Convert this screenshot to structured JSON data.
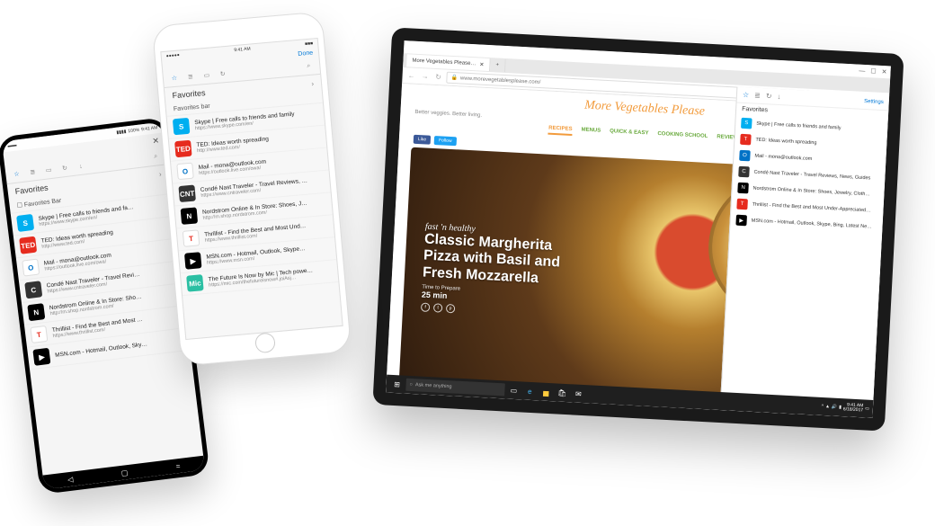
{
  "android": {
    "status": {
      "left": "▬▬",
      "battery": "100%",
      "time": "9:41 AM",
      "signal": "▮▮▮▮"
    },
    "close_glyph": "✕",
    "search_glyph": "⌕",
    "tabs": {
      "star": "☆",
      "list": "≣",
      "book": "▭",
      "clock": "↻",
      "arrow": "↓"
    },
    "header": "Favorites",
    "chevron": "›",
    "favorites_bar_label": "Favorites Bar",
    "items": [
      {
        "iconBg": "#00aff0",
        "iconTxt": "S",
        "title": "Skype | Free calls to friends and fa…",
        "url": "https://www.skype.com/en/"
      },
      {
        "iconBg": "#e62b1e",
        "iconTxt": "TED",
        "title": "TED: Ideas worth spreading",
        "url": "http://www.ted.com/"
      },
      {
        "iconBg": "#fff",
        "iconTxt": "O",
        "iconColor": "#0072c6",
        "title": "Mail - mona@outlook.com",
        "url": "https://outlook.live.com/owa/"
      },
      {
        "iconBg": "#333",
        "iconTxt": "C",
        "title": "Condé Nast Traveler - Travel Revi…",
        "url": "https://www.cntraveler.com/"
      },
      {
        "iconBg": "#000",
        "iconTxt": "N",
        "title": "Nordstrom Online & In Store: Sho…",
        "url": "http://m.shop.nordstrom.com/"
      },
      {
        "iconBg": "#fff",
        "iconTxt": "T",
        "iconColor": "#e62b1e",
        "title": "Thrillist - Find the Best and Most …",
        "url": "https://www.thrillist.com/"
      },
      {
        "iconBg": "#000",
        "iconTxt": "▶",
        "title": "MSN.com - Hotmail, Outlook, Sky…",
        "url": ""
      }
    ],
    "nav": {
      "back": "◁",
      "home": "▢",
      "recent": "="
    }
  },
  "iphone": {
    "status": {
      "carrier": "●●●●●",
      "time": "9:41 AM",
      "battery": "■■■"
    },
    "done_label": "Done",
    "tabs": {
      "star": "☆",
      "list": "≣",
      "book": "▭",
      "clock": "↻"
    },
    "search_glyph": "⌕",
    "header": "Favorites",
    "chevron": "›",
    "favorites_bar_label": "Favorites bar",
    "items": [
      {
        "iconBg": "#00aff0",
        "iconTxt": "S",
        "title": "Skype | Free calls to friends and family",
        "url": "https://www.skype.com/en/"
      },
      {
        "iconBg": "#e62b1e",
        "iconTxt": "TED",
        "title": "TED: Ideas worth spreading",
        "url": "http://www.ted.com/"
      },
      {
        "iconBg": "#fff",
        "iconTxt": "O",
        "iconColor": "#0072c6",
        "title": "Mail - mona@outlook.com",
        "url": "https://outlook.live.com/owa/"
      },
      {
        "iconBg": "#333",
        "iconTxt": "CNT",
        "title": "Condé Nast Traveler - Travel Reviews, …",
        "url": "https://www.cntraveler.com/"
      },
      {
        "iconBg": "#000",
        "iconTxt": "N",
        "title": "Nordstrom Online & In Store: Shoes, J…",
        "url": "http://m.shop.nordstrom.com/"
      },
      {
        "iconBg": "#fff",
        "iconTxt": "T",
        "iconColor": "#e62b1e",
        "title": "Thrillist - Find the Best and Most Und…",
        "url": "https://www.thrillist.com/"
      },
      {
        "iconBg": "#000",
        "iconTxt": "▶",
        "title": "MSN.com - Hotmail, Outlook, Skype…",
        "url": "https://www.msn.com/"
      },
      {
        "iconBg": "#2bbfa3",
        "iconTxt": "Mic",
        "title": "The Future Is Now by Mic | Tech powe…",
        "url": "https://mic.com/thefutureisnow#.joiAsj…"
      }
    ]
  },
  "tablet": {
    "window": {
      "min": "—",
      "max": "☐",
      "close": "✕"
    },
    "tab": {
      "title": "More Vegetables Please…",
      "close": "✕",
      "plus": "+"
    },
    "addr": {
      "back": "←",
      "fwd": "→",
      "reload": "↻",
      "lock": "🔒",
      "url": "www.morevegetablesplease.com/",
      "ellipsis": "⋯",
      "icons": {
        "book": "▭",
        "star": "☆",
        "stars": "☆≡",
        "people": "👤",
        "share": "↗",
        "more": "⋯"
      }
    },
    "site": {
      "title": "More Vegetables Please",
      "tagline": "Better veggies. Better living.",
      "nav": [
        "RECIPES",
        "MENUS",
        "QUICK & EASY",
        "COOKING SCHOOL",
        "REVIEW"
      ],
      "social": {
        "like": "Like",
        "follow": "Follow"
      },
      "hero": {
        "cursive": "fast 'n healthy",
        "h1": "Classic Margherita",
        "h2": "Pizza with Basil and",
        "h3": "Fresh Mozzarella",
        "tp_label": "Time to Prepare",
        "tp_val": "25 min",
        "fb": "f",
        "tw": "t",
        "pi": "p"
      }
    },
    "flyout": {
      "icons": {
        "star": "☆",
        "list": "≣",
        "clock": "↻",
        "down": "↓"
      },
      "settings": "Settings",
      "header": "Favorites",
      "items": [
        {
          "iconBg": "#00aff0",
          "iconTxt": "S",
          "title": "Skype | Free calls to friends and family"
        },
        {
          "iconBg": "#e62b1e",
          "iconTxt": "T",
          "title": "TED: Ideas worth spreading"
        },
        {
          "iconBg": "#0072c6",
          "iconTxt": "O",
          "title": "Mail - mona@outlook.com"
        },
        {
          "iconBg": "#333",
          "iconTxt": "C",
          "title": "Condé Nast Traveler - Travel Reviews, News, Guides"
        },
        {
          "iconBg": "#000",
          "iconTxt": "N",
          "title": "Nordstrom Online & In Store: Shoes, Jewelry, Cloth…"
        },
        {
          "iconBg": "#e62b1e",
          "iconTxt": "T",
          "title": "Thrillist - Find the Best and Most Under-Appreciated…"
        },
        {
          "iconBg": "#000",
          "iconTxt": "▶",
          "title": "MSN.com - Hotmail, Outlook, Skype, Bing, Latest Ne…"
        }
      ]
    },
    "taskbar": {
      "win": "⊞",
      "search_placeholder": "Ask me anything",
      "cortana": "○",
      "task": "▭",
      "edge": "e",
      "folder": "▅",
      "store": "🛍",
      "mail": "✉",
      "right": {
        "up": "^",
        "wifi": "▲",
        "vol": "🔊",
        "batt": "▮",
        "time": "9:41 AM",
        "date": "6/18/2017",
        "action": "▭"
      }
    }
  }
}
